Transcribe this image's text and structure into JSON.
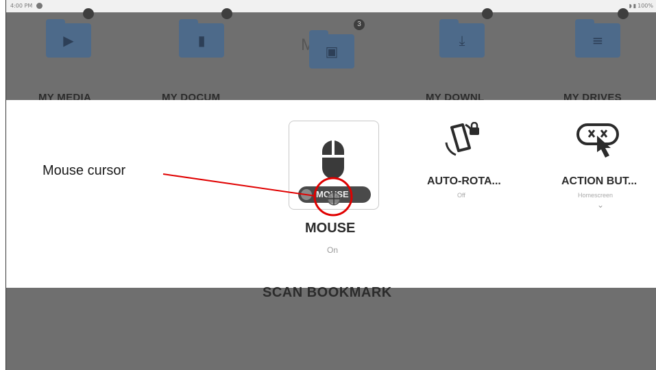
{
  "status_bar": {
    "time": "4:00 PM",
    "battery": "100%"
  },
  "home": {
    "folders": [
      {
        "label": "MY MEDIA",
        "icon": "play-icon",
        "glyph": "▶"
      },
      {
        "label": "MY DOCUM",
        "icon": "document-icon",
        "glyph": "▮"
      },
      {
        "label": "",
        "icon": "image-icon",
        "glyph": "▣",
        "badge": "3",
        "ghost": "M        s"
      },
      {
        "label": "MY DOWNL",
        "icon": "download-icon",
        "glyph": "⤓"
      },
      {
        "label": "MY DRIVES",
        "icon": "list-icon",
        "glyph": "≡"
      }
    ]
  },
  "quick_settings": {
    "tiles": [
      {
        "label": "MOUSE",
        "state": "On",
        "pill_label": "MOUSE",
        "icon": "mouse-icon"
      },
      {
        "label": "AUTO-ROTA...",
        "state": "Off",
        "icon": "rotate-lock-icon"
      },
      {
        "label": "ACTION BUT...",
        "state": "Homescreen",
        "icon": "tap-gesture-icon"
      }
    ]
  },
  "bottom": {
    "scan_label": "SCAN BOOKMARK"
  },
  "annotation": {
    "text": "Mouse cursor",
    "color": "#e00000"
  }
}
